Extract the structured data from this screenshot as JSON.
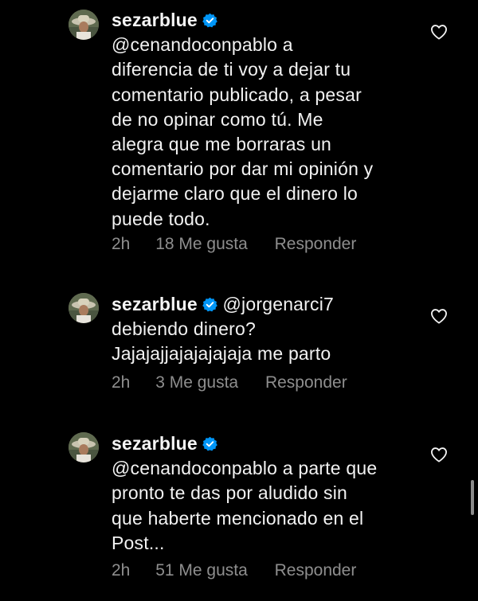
{
  "colors": {
    "background": "#000000",
    "text": "#f2f2f2",
    "meta": "#8e8e8e",
    "verified": "#0095f6"
  },
  "comments": [
    {
      "username": "sezarblue",
      "verified": true,
      "mention": "",
      "lines": [
        "@cenandoconpablo a",
        "diferencia de ti voy a dejar tu",
        "comentario publicado, a pesar",
        "de no opinar como tú. Me",
        "alegra que me borraras un",
        "comentario por dar mi opinión y",
        "dejarme claro que el dinero lo",
        "puede todo."
      ],
      "time": "2h",
      "likes": "18 Me gusta",
      "reply": "Responder",
      "heart_icon": "heart-outline-icon"
    },
    {
      "username": "sezarblue",
      "verified": true,
      "mention": "@jorgenarci7",
      "lines": [
        "debiendo dinero?",
        "Jajajajjajajajajaja me parto"
      ],
      "time": "2h",
      "likes": "3 Me gusta",
      "reply": "Responder",
      "heart_icon": "heart-outline-icon"
    },
    {
      "username": "sezarblue",
      "verified": true,
      "mention": "",
      "lines": [
        "@cenandoconpablo a parte que",
        "pronto te das por aludido sin",
        "que haberte mencionado en el",
        "Post..."
      ],
      "time": "2h",
      "likes": "51 Me gusta",
      "reply": "Responder",
      "heart_icon": "heart-outline-icon"
    }
  ]
}
